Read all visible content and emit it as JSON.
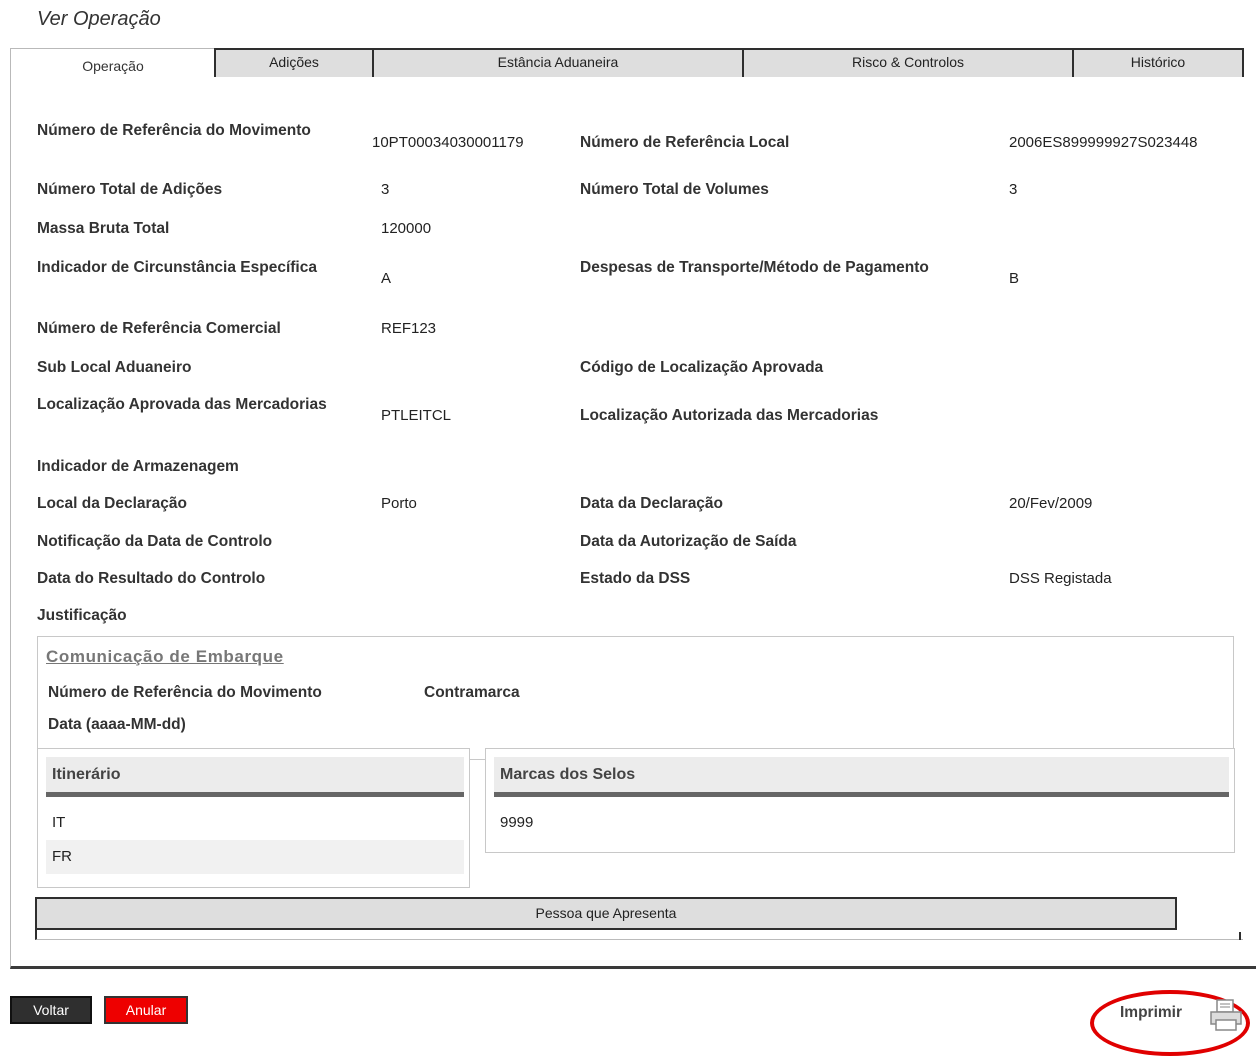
{
  "page_title": "Ver Operação",
  "tabs": [
    {
      "label": "Operação",
      "active": true
    },
    {
      "label": "Adições",
      "active": false
    },
    {
      "label": "Estância Aduaneira",
      "active": false
    },
    {
      "label": "Risco & Controlos",
      "active": false
    },
    {
      "label": "Histórico",
      "active": false
    }
  ],
  "fields": {
    "mrn_label": "Número de Referência do Movimento",
    "mrn_value": "10PT00034030001179",
    "lrn_label": "Número de Referência Local",
    "lrn_value": "2006ES899999927S023448",
    "total_items_label": "Número Total de Adições",
    "total_items_value": "3",
    "total_packages_label": "Número Total de Volumes",
    "total_packages_value": "3",
    "gross_mass_label": "Massa Bruta Total",
    "gross_mass_value": "120000",
    "specific_circumstance_label": "Indicador de Circunstância Específica",
    "specific_circumstance_value": "A",
    "transport_payment_label": "Despesas de Transporte/Método de Pagamento",
    "transport_payment_value": "B",
    "commercial_ref_label": "Número de Referência Comercial",
    "commercial_ref_value": "REF123",
    "sub_location_label": "Sub Local Aduaneiro",
    "approved_location_code_label": "Código de Localização Aprovada",
    "approved_location_label": "Localização Aprovada das Mercadorias",
    "approved_location_value": "PTLEITCL",
    "authorised_location_label": "Localização Autorizada das Mercadorias",
    "storage_indicator_label": "Indicador de Armazenagem",
    "declaration_place_label": "Local da Declaração",
    "declaration_place_value": "Porto",
    "declaration_date_label": "Data da Declaração",
    "declaration_date_value": "20/Fev/2009",
    "control_date_notification_label": "Notificação da Data de Controlo",
    "exit_release_date_label": "Data da Autorização de Saída",
    "control_result_date_label": "Data do Resultado do Controlo",
    "dss_state_label": "Estado da DSS",
    "dss_state_value": "DSS Registada",
    "justification_label": "Justificação"
  },
  "embarque": {
    "title": "Comunicação de Embarque",
    "mrn_label": "Número de Referência do Movimento",
    "counter_mark_label": "Contramarca",
    "date_label": "Data (aaaa-MM-dd)"
  },
  "itinerario": {
    "header": "Itinerário",
    "rows": [
      "IT",
      "FR"
    ]
  },
  "selos": {
    "header": "Marcas dos Selos",
    "rows": [
      "9999"
    ]
  },
  "pessoa": {
    "header": "Pessoa que Apresenta"
  },
  "buttons": {
    "voltar": "Voltar",
    "anular": "Anular"
  },
  "print": {
    "label": "Imprimir",
    "icon": "printer-icon",
    "highlight_color": "#e00000"
  },
  "colors": {
    "anular_bg": "#ee0000",
    "voltar_bg": "#2f2f2f",
    "tab_bg": "#dedede"
  }
}
